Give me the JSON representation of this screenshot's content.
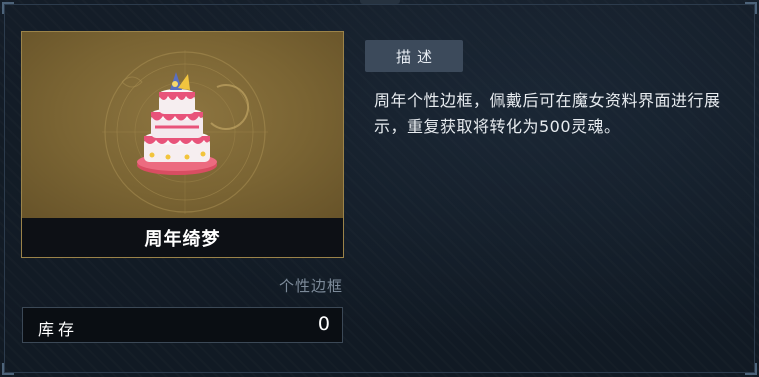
{
  "item": {
    "name": "周年绮梦",
    "type": "个性边框",
    "icon": "anniversary-cake-icon"
  },
  "stock": {
    "label": "库存",
    "value": "0"
  },
  "description": {
    "tab_label": "描述",
    "text": "周年个性边框，佩戴后可在魔女资料界面进行展示，重复获取将转化为500灵魂。"
  },
  "colors": {
    "card_border": "#9b8349",
    "art_background": "#7a6433",
    "tab_background": "#3c4a5b",
    "panel_background": "#111a24"
  }
}
